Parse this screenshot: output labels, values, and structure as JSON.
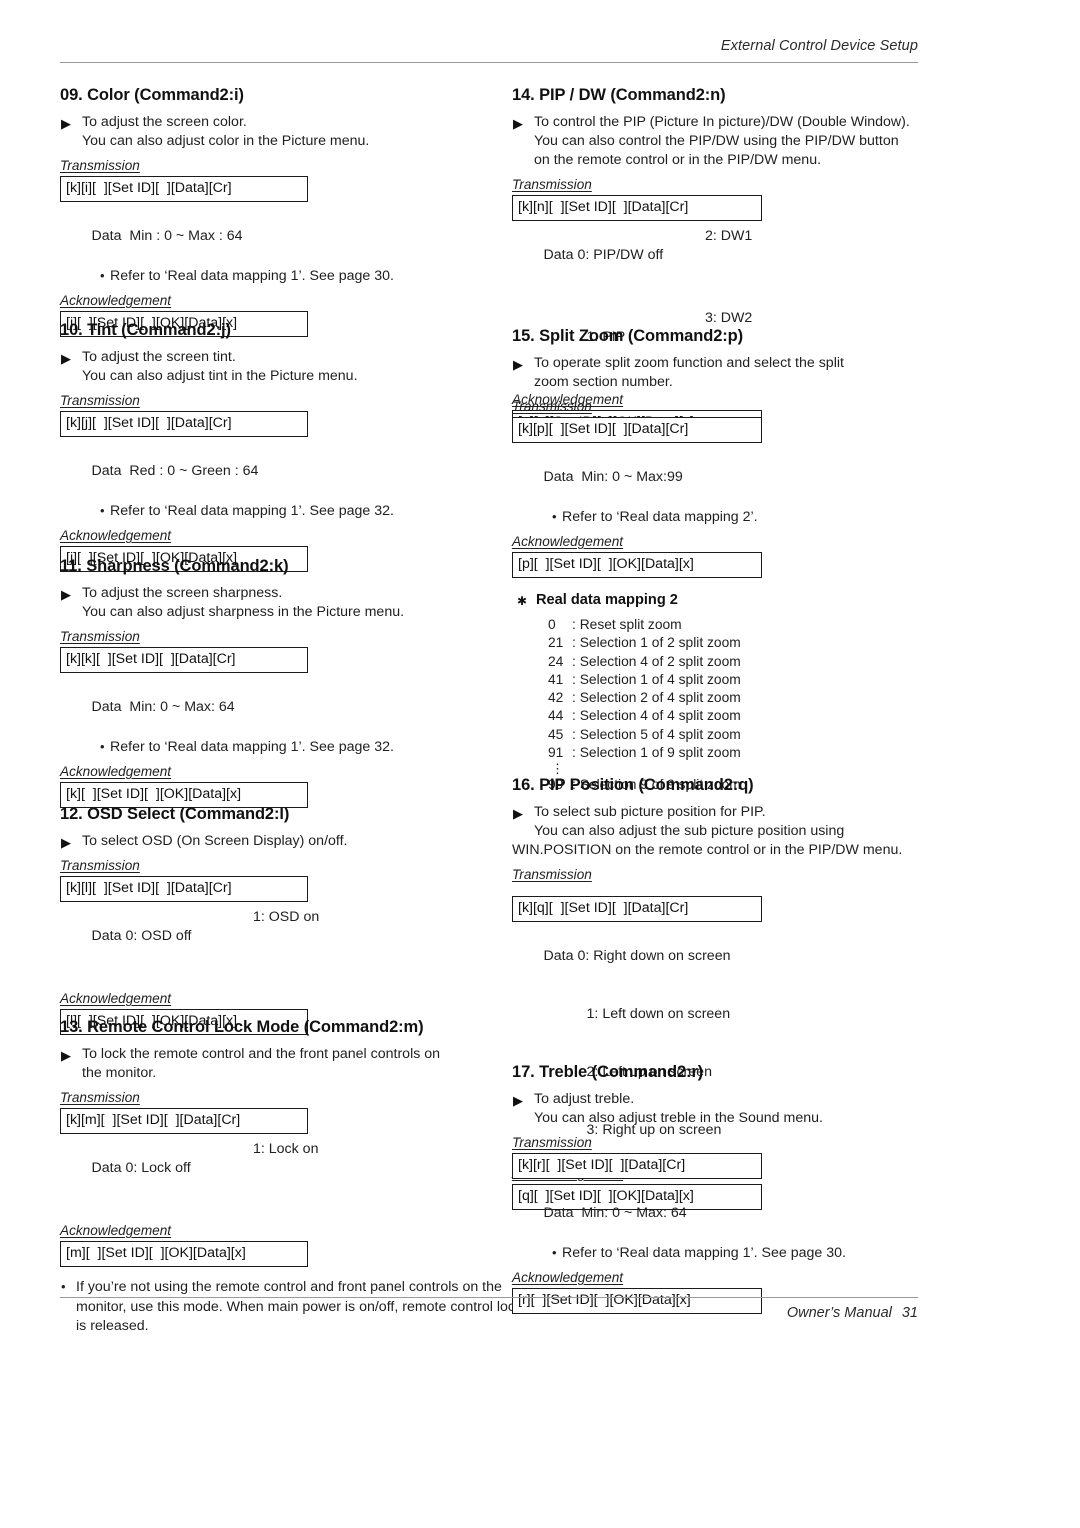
{
  "header": {
    "title": "External Control Device Setup"
  },
  "footer": {
    "label": "Owner’s Manual",
    "page": "31"
  },
  "markers": {
    "triangle": "▶",
    "bullet": "•",
    "star": "✱",
    "vdots": "⋮"
  },
  "left_column": [
    {
      "title": "09. Color (Command2:i)",
      "desc_line1": "To adjust the screen color.",
      "desc_line2": "You can also adjust color in the Picture menu.",
      "transmission_label": "Transmission",
      "transmission": "[k][i][  ][Set ID][  ][Data][Cr]",
      "data_label": "Data",
      "data_col1": "Min : 0 ~ Max : 64",
      "data_col2": "",
      "ref": "Refer to ‘Real data mapping 1’. See page 30.",
      "ack_label": "Acknowledgement",
      "ack": "[i][  ][Set ID][  ][OK][Data][x]"
    },
    {
      "title": "10. Tint (Command2:j)",
      "desc_line1": "To adjust the screen tint.",
      "desc_line2": "You can also adjust tint in the Picture menu.",
      "transmission_label": "Transmission",
      "transmission": "[k][j][  ][Set ID][  ][Data][Cr]",
      "data_label": "Data",
      "data_col1": "Red : 0 ~ Green : 64",
      "data_col2": "",
      "ref": "Refer to ‘Real data mapping 1’. See page 32.",
      "ack_label": "Acknowledgement",
      "ack": "[j][  ][Set ID][  ][OK][Data][x]"
    },
    {
      "title": "11. Sharpness (Command2:k)",
      "desc_line1": "To adjust the screen sharpness.",
      "desc_line2": "You can also adjust sharpness in the Picture menu.",
      "transmission_label": "Transmission",
      "transmission": "[k][k][  ][Set ID][  ][Data][Cr]",
      "data_label": "Data",
      "data_col1": "Min: 0 ~ Max: 64",
      "data_col2": "",
      "ref": "Refer to ‘Real data mapping 1’. See page 32.",
      "ack_label": "Acknowledgement",
      "ack": "[k][  ][Set ID][  ][OK][Data][x]"
    },
    {
      "title": "12. OSD Select (Command2:l)",
      "desc_line1": "To select OSD (On Screen Display) on/off.",
      "desc_line2": "",
      "transmission_label": "Transmission",
      "transmission": "[k][l][  ][Set ID][  ][Data][Cr]",
      "data_label": "Data",
      "data_col1": "0: OSD off",
      "data_col2": "1: OSD on",
      "ref": "",
      "ack_label": "Acknowledgement",
      "ack": "[l][  ][Set ID][  ][OK][Data][x]"
    },
    {
      "title": "13. Remote Control Lock Mode (Command2:m)",
      "desc_line1": "To lock the remote control and the front panel controls on",
      "desc_line2": "the monitor.",
      "transmission_label": "Transmission",
      "transmission": "[k][m][  ][Set ID][  ][Data][Cr]",
      "data_label": "Data",
      "data_col1": "0: Lock off",
      "data_col2": "1: Lock on",
      "ref": "",
      "ack_label": "Acknowledgement",
      "ack": "[m][  ][Set ID][  ][OK][Data][x]"
    }
  ],
  "left_note": {
    "line1": "If you’re not using the remote control and front panel controls",
    "line2": "on the monitor, use this mode. When main power is on/off,",
    "line3": "remote control lock is released."
  },
  "right_column": [
    {
      "title": "14. PIP / DW (Command2:n)",
      "desc_line1": "To control the PIP (Picture In picture)/DW (Double Window).",
      "desc_line2": "You can also control the PIP/DW using the PIP/DW button",
      "desc_line3": "on the remote control or in the PIP/DW menu.",
      "transmission_label": "Transmission",
      "transmission": "[k][n][  ][Set ID][  ][Data][Cr]",
      "data_label": "Data",
      "data_rows": [
        {
          "c1": "0: PIP/DW off",
          "c2": "2: DW1"
        },
        {
          "c1": "1: PIP",
          "c2": "3: DW2"
        }
      ],
      "ref": "",
      "ack_label": "Acknowledgement",
      "ack": "[n][  ][Set ID][  ][OK][Data][x]"
    },
    {
      "title": "15. Split Zoom (Command2:p)",
      "desc_line1": "To operate split zoom function and select the split",
      "desc_line2": "zoom section number.",
      "desc_line3": "",
      "transmission_label": "Transmission",
      "transmission": "[k][p][  ][Set ID][  ][Data][Cr]",
      "data_label": "Data",
      "data_rows": [
        {
          "c1": "Min: 0 ~ Max:99",
          "c2": ""
        }
      ],
      "ref": "Refer to ‘Real data mapping 2’.",
      "ack_label": "Acknowledgement",
      "ack": "[p][  ][Set ID][  ][OK][Data][x]"
    },
    {
      "title": "16. PIP Position (Command2:q)",
      "desc_line1": "To select sub picture position for PIP.",
      "desc_line2": "You can also adjust the sub picture position using",
      "desc_line3": "WIN.POSITION on the remote control or in the PIP/DW menu.",
      "transmission_label": "Transmission",
      "transmission": "[k][q][  ][Set ID][  ][Data][Cr]",
      "data_label": "Data",
      "data_rows": [
        {
          "c1": "0: Right down on screen",
          "c2": ""
        },
        {
          "c1": "1: Left down on screen",
          "c2": ""
        },
        {
          "c1": "2: Left up on screen",
          "c2": ""
        },
        {
          "c1": "3: Right up on screen",
          "c2": ""
        }
      ],
      "ref": "",
      "ack_label": "Acknowledgement",
      "ack": "[q][  ][Set ID][  ][OK][Data][x]"
    },
    {
      "title": "17. Treble (Command2:r)",
      "desc_line1": "To adjust treble.",
      "desc_line2": "You can also adjust treble in the Sound menu.",
      "desc_line3": "",
      "transmission_label": "Transmission",
      "transmission": "[k][r][  ][Set ID][  ][Data][Cr]",
      "data_label": "Data",
      "data_rows": [
        {
          "c1": "Min: 0 ~ Max: 64",
          "c2": ""
        }
      ],
      "ref": "Refer to ‘Real data mapping 1’. See page 30.",
      "ack_label": "Acknowledgement",
      "ack": "[r][  ][Set ID][  ][OK][Data][x]"
    }
  ],
  "real_data_mapping_2": {
    "title": "Real data mapping 2",
    "rows": [
      {
        "key": "0",
        "sep": ":",
        "text": "Reset split zoom"
      },
      {
        "key": "21",
        "sep": ":",
        "text": "Selection 1 of 2 split zoom"
      },
      {
        "key": "24",
        "sep": ":",
        "text": "Selection 4 of 2 split zoom"
      },
      {
        "key": "41",
        "sep": ":",
        "text": "Selection 1 of 4 split zoom"
      },
      {
        "key": "42",
        "sep": ":",
        "text": "Selection 2 of 4 split zoom"
      },
      {
        "key": "44",
        "sep": ":",
        "text": "Selection 4 of 4 split zoom"
      },
      {
        "key": "45",
        "sep": ":",
        "text": "Selection 5 of 4 split zoom"
      },
      {
        "key": "91",
        "sep": ":",
        "text": "Selection 1 of 9 split zoom"
      },
      {
        "key": "99",
        "sep": ":",
        "text": "Selection 9 of 9 split zoom"
      }
    ]
  }
}
